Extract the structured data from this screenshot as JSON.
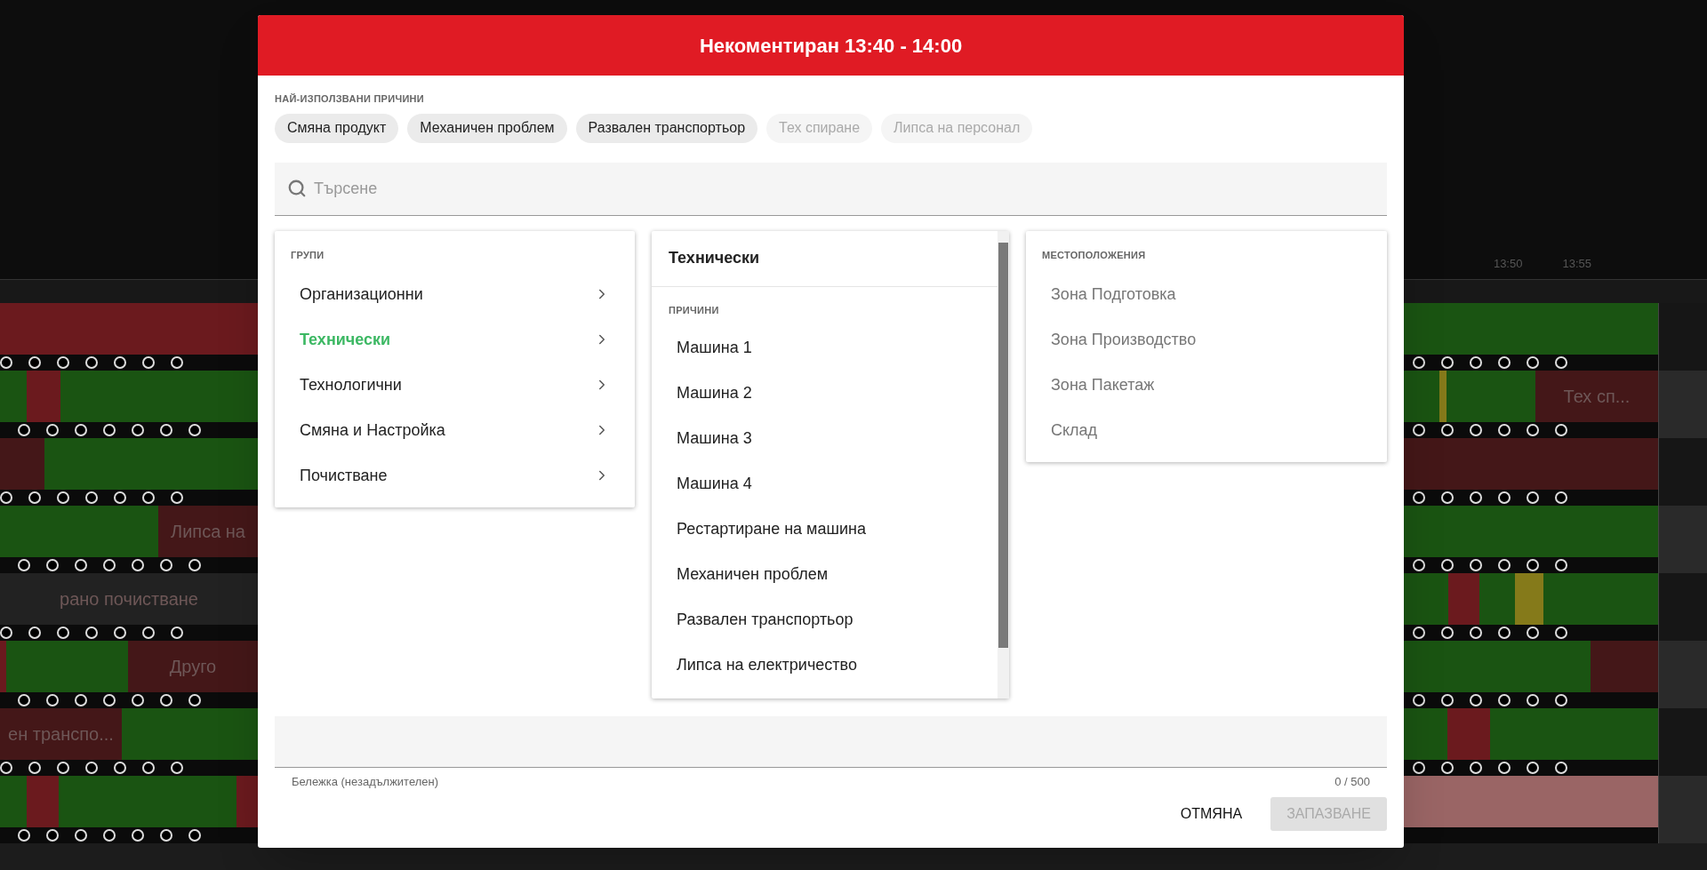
{
  "background": {
    "time_ticks": [
      "13:50",
      "13:55"
    ],
    "timeline_rows": [
      {
        "selected": false
      },
      {
        "selected": false,
        "right_label": "Тех сп..."
      },
      {
        "selected": false
      },
      {
        "selected": false,
        "left_label": "Липса на"
      },
      {
        "selected": false,
        "left_label": "рано почистване"
      },
      {
        "selected": false,
        "left_label": "Друго"
      },
      {
        "selected": false,
        "left_label": "ен транспо..."
      },
      {
        "selected": true
      }
    ]
  },
  "dialog": {
    "title": "Некоментиран 13:40 - 14:00",
    "frequent_label": "НАЙ-ИЗПОЛЗВАНИ ПРИЧИНИ",
    "chips": [
      {
        "label": "Смяна продукт",
        "disabled": false
      },
      {
        "label": "Механичен проблем",
        "disabled": false
      },
      {
        "label": "Развален транспортьор",
        "disabled": false
      },
      {
        "label": "Тех спиране",
        "disabled": true
      },
      {
        "label": "Липса на персонал",
        "disabled": true
      }
    ],
    "search": {
      "placeholder": "Търсене"
    },
    "groups": {
      "heading": "ГРУПИ",
      "items": [
        {
          "label": "Организационни",
          "selected": false
        },
        {
          "label": "Технически",
          "selected": true
        },
        {
          "label": "Технологични",
          "selected": false
        },
        {
          "label": "Смяна и Настройка",
          "selected": false
        },
        {
          "label": "Почистване",
          "selected": false
        }
      ]
    },
    "reasons": {
      "title": "Технически",
      "heading": "ПРИЧИНИ",
      "items": [
        "Машина 1",
        "Машина 2",
        "Машина 3",
        "Машина 4",
        "Рестартиране на машина",
        "Механичен проблем",
        "Развален транспортьор",
        "Липса на електричество"
      ]
    },
    "locations": {
      "heading": "МЕСТОПОЛОЖЕНИЯ",
      "items": [
        {
          "label": "Зона Подготовка",
          "disabled": true
        },
        {
          "label": "Зона Производство",
          "disabled": true
        },
        {
          "label": "Зона Пакетаж",
          "disabled": true
        },
        {
          "label": "Склад",
          "disabled": true
        }
      ]
    },
    "note": {
      "helper": "Бележка (незадължителен)",
      "counter": "0 / 500"
    },
    "buttons": {
      "cancel": {
        "label": "ОТМЯНА",
        "disabled": false
      },
      "save": {
        "label": "ЗАПАЗВАНЕ",
        "disabled": true
      }
    }
  }
}
